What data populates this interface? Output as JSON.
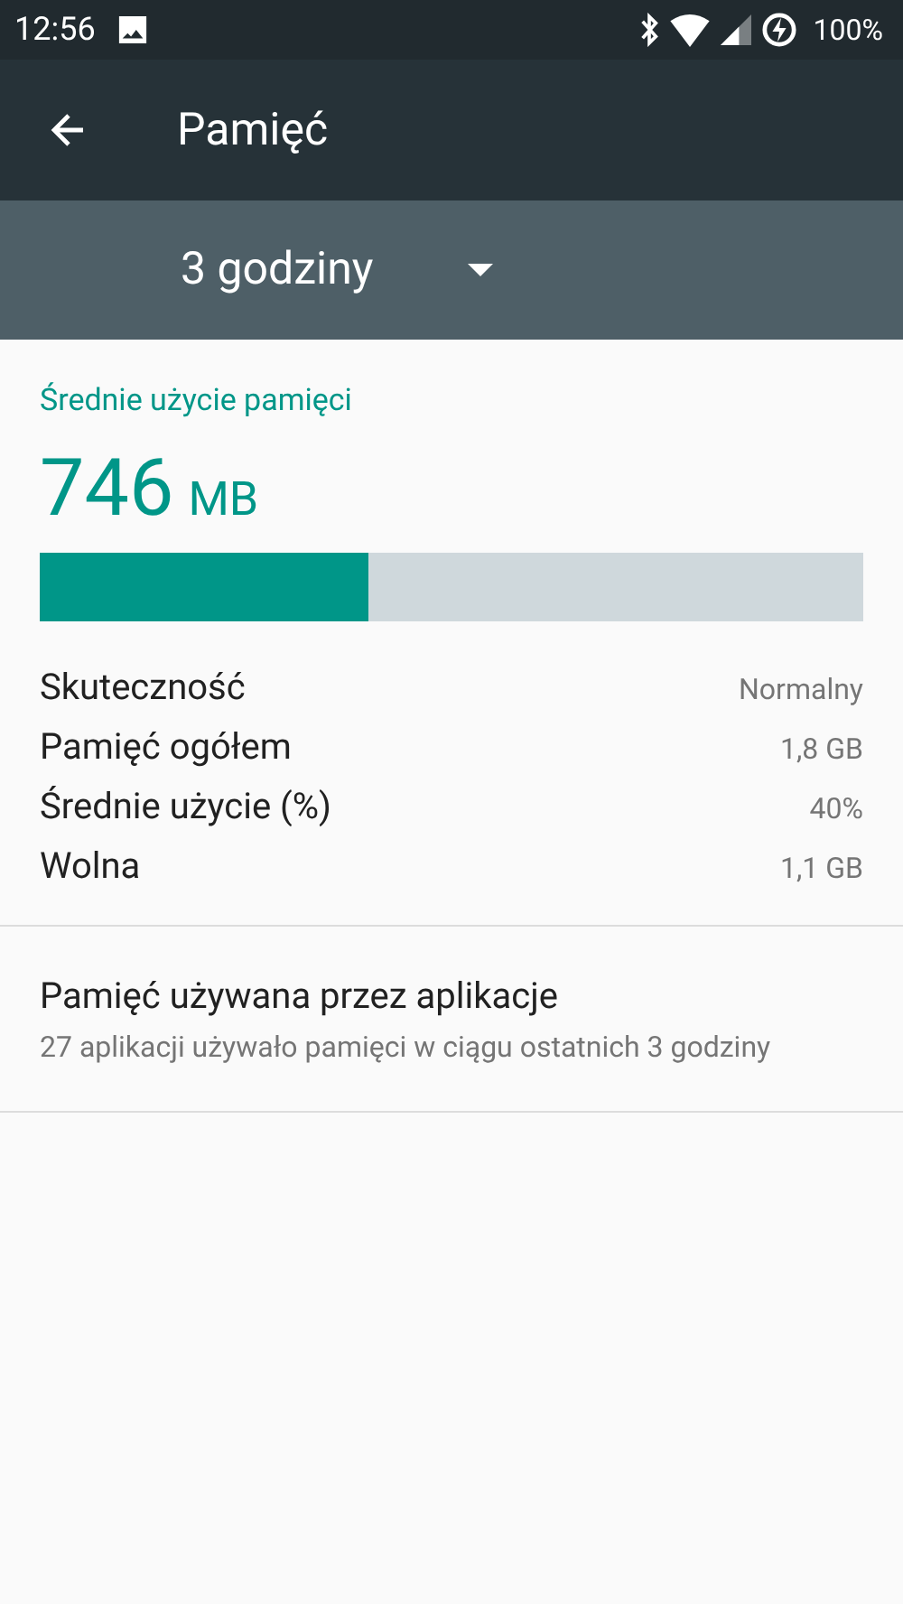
{
  "status_bar": {
    "time": "12:56",
    "battery": "100%"
  },
  "toolbar": {
    "title": "Pamięć"
  },
  "period": {
    "value": "3 godziny"
  },
  "memory": {
    "heading": "Średnie użycie pamięci",
    "amount": "746",
    "unit": "MB",
    "level": 0.4,
    "stats": [
      {
        "label": "Skuteczność",
        "value": "Normalny"
      },
      {
        "label": "Pamięć ogółem",
        "value": "1,8 GB"
      },
      {
        "label": "Średnie użycie (%)",
        "value": "40%"
      },
      {
        "label": "Wolna",
        "value": "1,1 GB"
      }
    ]
  },
  "apps": {
    "title": "Pamięć używana przez aplikacje",
    "summary": "27 aplikacji używało pamięci w ciągu ostatnich 3 godziny"
  }
}
